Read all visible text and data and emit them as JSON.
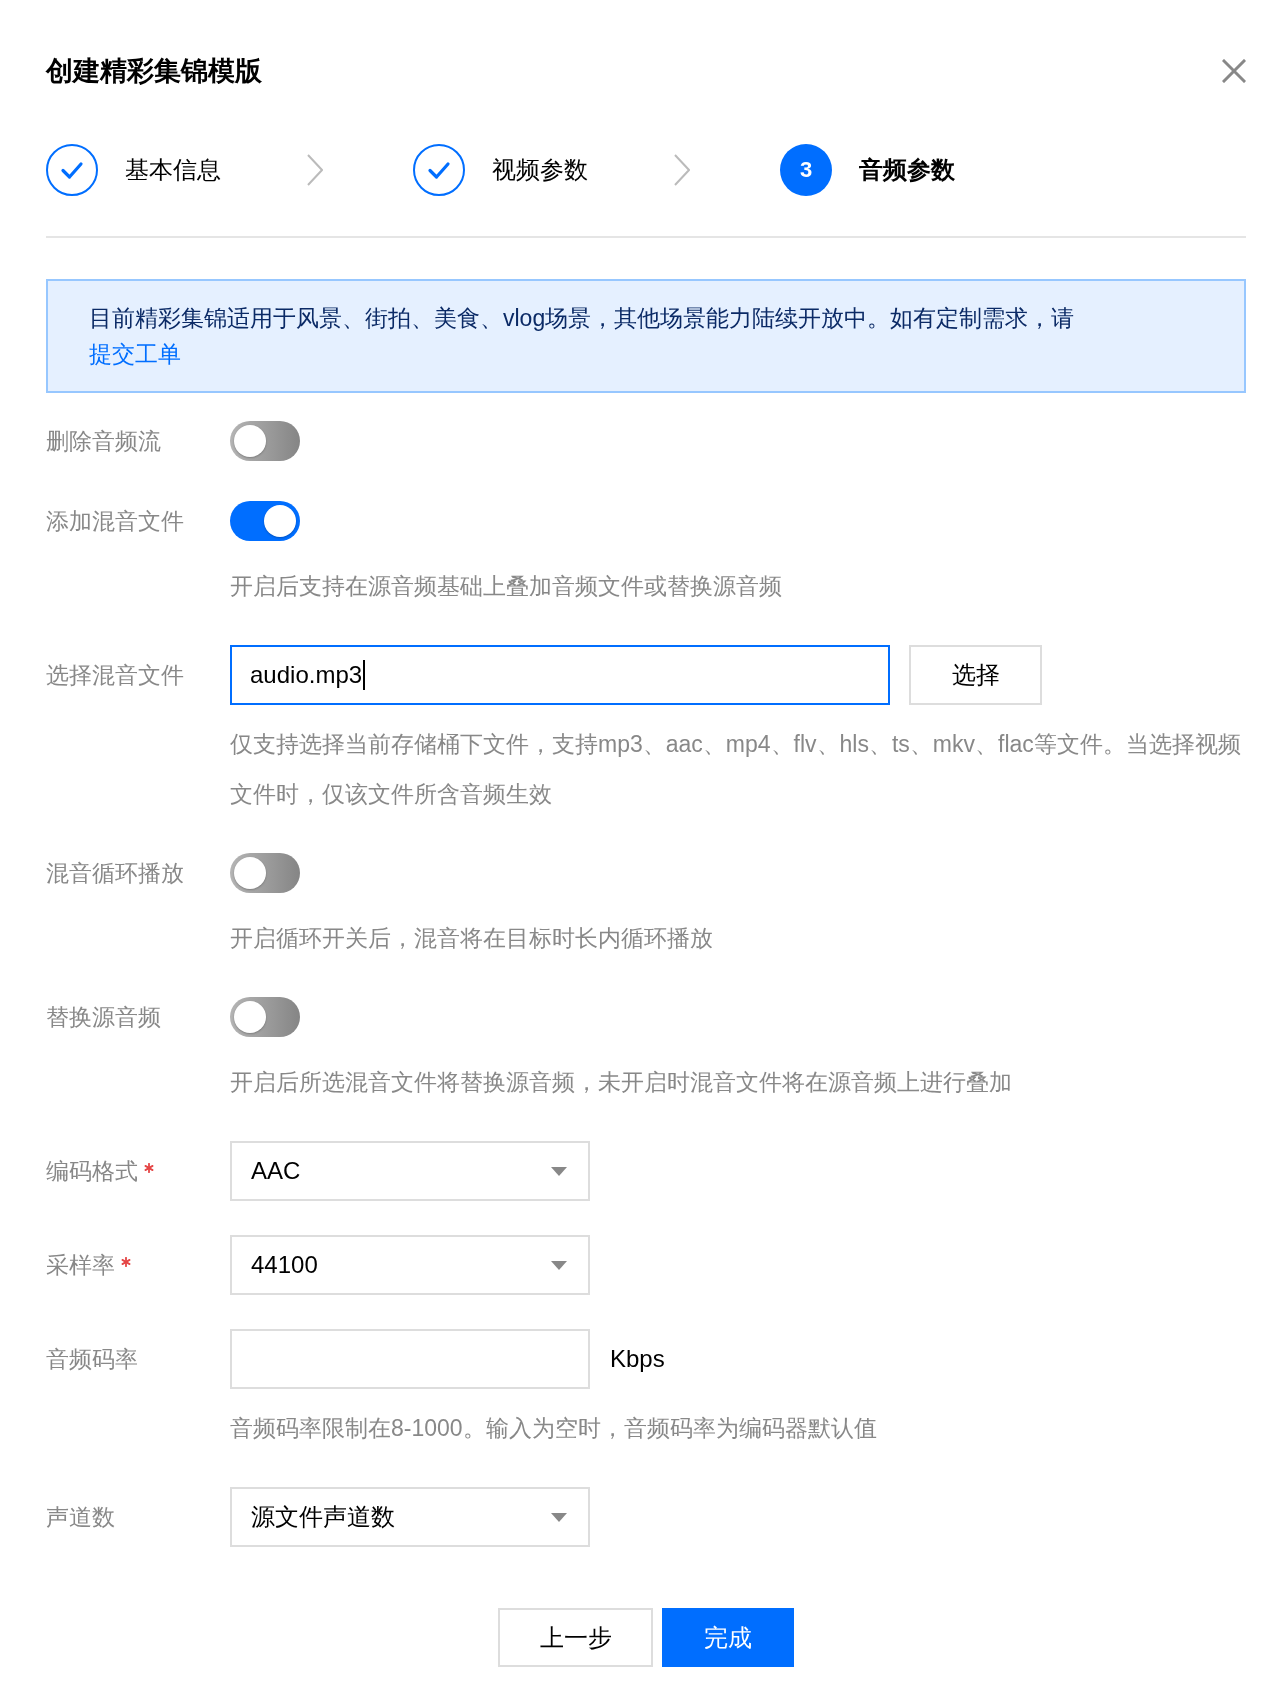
{
  "dialog": {
    "title": "创建精彩集锦模版"
  },
  "steps": [
    {
      "label": "基本信息",
      "done": true,
      "selected": false
    },
    {
      "label": "视频参数",
      "done": true,
      "selected": false
    },
    {
      "label": "音频参数",
      "done": false,
      "selected": true,
      "number": "3"
    }
  ],
  "notice": {
    "text": "目前精彩集锦适用于风景、街拍、美食、vlog场景，其他场景能力陆续开放中。如有定制需求，请",
    "link": "提交工单"
  },
  "fields": [
    {
      "kind": "toggle",
      "label": "删除音频流",
      "required": false,
      "on": false
    },
    {
      "kind": "toggle",
      "label": "添加混音文件",
      "required": false,
      "on": true,
      "hint": "开启后支持在源音频基础上叠加音频文件或替换源音频"
    },
    {
      "kind": "file",
      "label": "选择混音文件",
      "required": false,
      "value": "audio.mp3",
      "focused": true,
      "button": "选择",
      "hint": "仅支持选择当前存储桶下文件，支持mp3、aac、mp4、flv、hls、ts、mkv、flac等文件。当选择视频文件时，仅该文件所含音频生效"
    },
    {
      "kind": "toggle",
      "label": "混音循环播放",
      "required": false,
      "on": false,
      "hint": "开启循环开关后，混音将在目标时长内循环播放"
    },
    {
      "kind": "toggle",
      "label": "替换源音频",
      "required": false,
      "on": false,
      "hint": "开启后所选混音文件将替换源音频，未开启时混音文件将在源音频上进行叠加"
    },
    {
      "kind": "select",
      "label": "编码格式",
      "required": true,
      "value": "AAC"
    },
    {
      "kind": "select",
      "label": "采样率",
      "required": true,
      "value": "44100"
    },
    {
      "kind": "input",
      "label": "音频码率",
      "required": false,
      "unit": "Kbps",
      "hint": "音频码率限制在8-1000。输入为空时，音频码率为编码器默认值"
    },
    {
      "kind": "select",
      "label": "声道数",
      "required": false,
      "value": "源文件声道数"
    }
  ],
  "buttons": [
    {
      "label": "上一步",
      "kind": "secondary"
    },
    {
      "label": "完成",
      "kind": "primary"
    }
  ]
}
